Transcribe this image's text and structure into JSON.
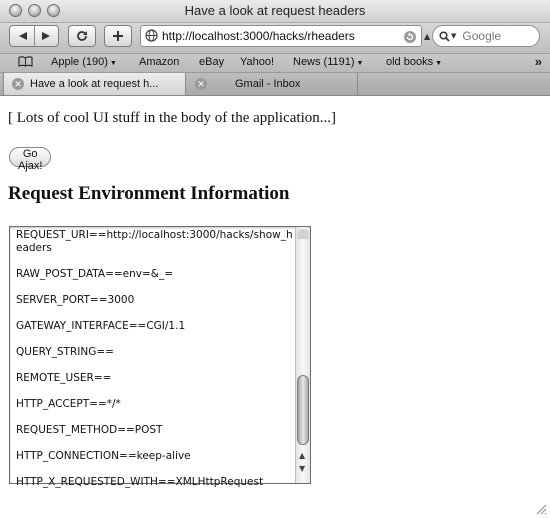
{
  "window": {
    "title": "Have a look at request headers"
  },
  "toolbar": {
    "back_icon": "back-arrow-icon",
    "forward_icon": "forward-arrow-icon",
    "reload_icon": "reload-icon",
    "add_icon": "plus-icon",
    "url": "http://localhost:3000/hacks/rheaders",
    "search_placeholder": "Google"
  },
  "bookmarks": {
    "items": [
      {
        "label": "Apple (190)",
        "menu": true
      },
      {
        "label": "Amazon",
        "menu": false
      },
      {
        "label": "eBay",
        "menu": false
      },
      {
        "label": "Yahoo!",
        "menu": false
      },
      {
        "label": "News (1191)",
        "menu": true
      },
      {
        "label": "old books",
        "menu": true
      }
    ],
    "more_glyph": "»"
  },
  "tabs": [
    {
      "label": "Have a look at request h...",
      "active": true
    },
    {
      "label": "Gmail - Inbox",
      "active": false
    }
  ],
  "page": {
    "intro": "[ Lots of cool UI stuff in the body of the application...]",
    "ajax_button": "Go Ajax!",
    "section_title": "Request Environment Information",
    "env_entries": [
      "REQUEST_URI==http://localhost:3000/hacks/show_headers",
      "RAW_POST_DATA==env=&_=",
      "SERVER_PORT==3000",
      "GATEWAY_INTERFACE==CGI/1.1",
      "QUERY_STRING==",
      "REMOTE_USER==",
      "HTTP_ACCEPT==*/*",
      "REQUEST_METHOD==POST",
      "HTTP_CONNECTION==keep-alive",
      "HTTP_X_REQUESTED_WITH==XMLHttpRequest"
    ]
  },
  "colors": {
    "chrome": "#c4c4c4",
    "page_bg": "#ffffff",
    "text": "#111111"
  }
}
